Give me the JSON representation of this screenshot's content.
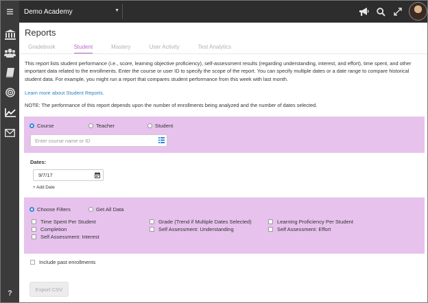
{
  "topbar": {
    "account_name": "Demo Academy",
    "icons": [
      "megaphone-icon",
      "search-icon",
      "expand-icon"
    ]
  },
  "sidebar": {
    "icons": [
      "menu-icon",
      "institution-icon",
      "users-icon",
      "book-icon",
      "target-icon",
      "reports-chart-icon",
      "mail-icon",
      "help-icon"
    ],
    "help_label": "?"
  },
  "page": {
    "title": "Reports",
    "tabs": [
      {
        "label": "Gradebook",
        "active": false
      },
      {
        "label": "Student",
        "active": true
      },
      {
        "label": "Mastery",
        "active": false
      },
      {
        "label": "User Activity",
        "active": false
      },
      {
        "label": "Test Analytics",
        "active": false
      }
    ],
    "description": "This report lists student performance (i.e., score, learning objective proficiency), self-assessment results (regarding understanding, interest, and effort), time spent, and other important data related to the enrollments. Enter the course or user ID to specify the scope of the report. You can specify multiple dates or a date range to compare historical student data. For example, you might run a report that compares student performance from this week with last month.",
    "learn_more": "Learn more about Student Reports.",
    "note": "NOTE: The performance of this report depends upon the number of enrollments being analyzed and the number of dates selected."
  },
  "scope": {
    "options": [
      {
        "label": "Course",
        "selected": true
      },
      {
        "label": "Teacher",
        "selected": false
      },
      {
        "label": "Student",
        "selected": false
      }
    ],
    "input_placeholder": "Enter course name or ID"
  },
  "dates": {
    "label": "Dates:",
    "value": "9/7/17",
    "add_label": "+ Add Date"
  },
  "filters": {
    "mode_options": [
      {
        "label": "Choose Filters",
        "selected": true
      },
      {
        "label": "Get All Data",
        "selected": false
      }
    ],
    "checkboxes": [
      {
        "label": "Time Spent Per Student",
        "checked": false
      },
      {
        "label": "Grade (Trend if Multiple Dates Selected)",
        "checked": false
      },
      {
        "label": "Learning Proficiency Per Student",
        "checked": false
      },
      {
        "label": "Completion",
        "checked": false
      },
      {
        "label": "Self Assessment: Understanding",
        "checked": false
      },
      {
        "label": "Self Assessment: Effort",
        "checked": false
      },
      {
        "label": "Self Assessment: Interest",
        "checked": false
      }
    ]
  },
  "include_past": {
    "label": "Include past enrollments",
    "checked": false
  },
  "export_button": {
    "label": "Export CSV",
    "enabled": false
  },
  "colors": {
    "accent": "#b46ac6",
    "panel": "#e7c2ed",
    "link": "#2a7fc0",
    "radio_on": "#2e86de",
    "topbar": "#2d2d2d",
    "rail": "#3b3b3b"
  }
}
